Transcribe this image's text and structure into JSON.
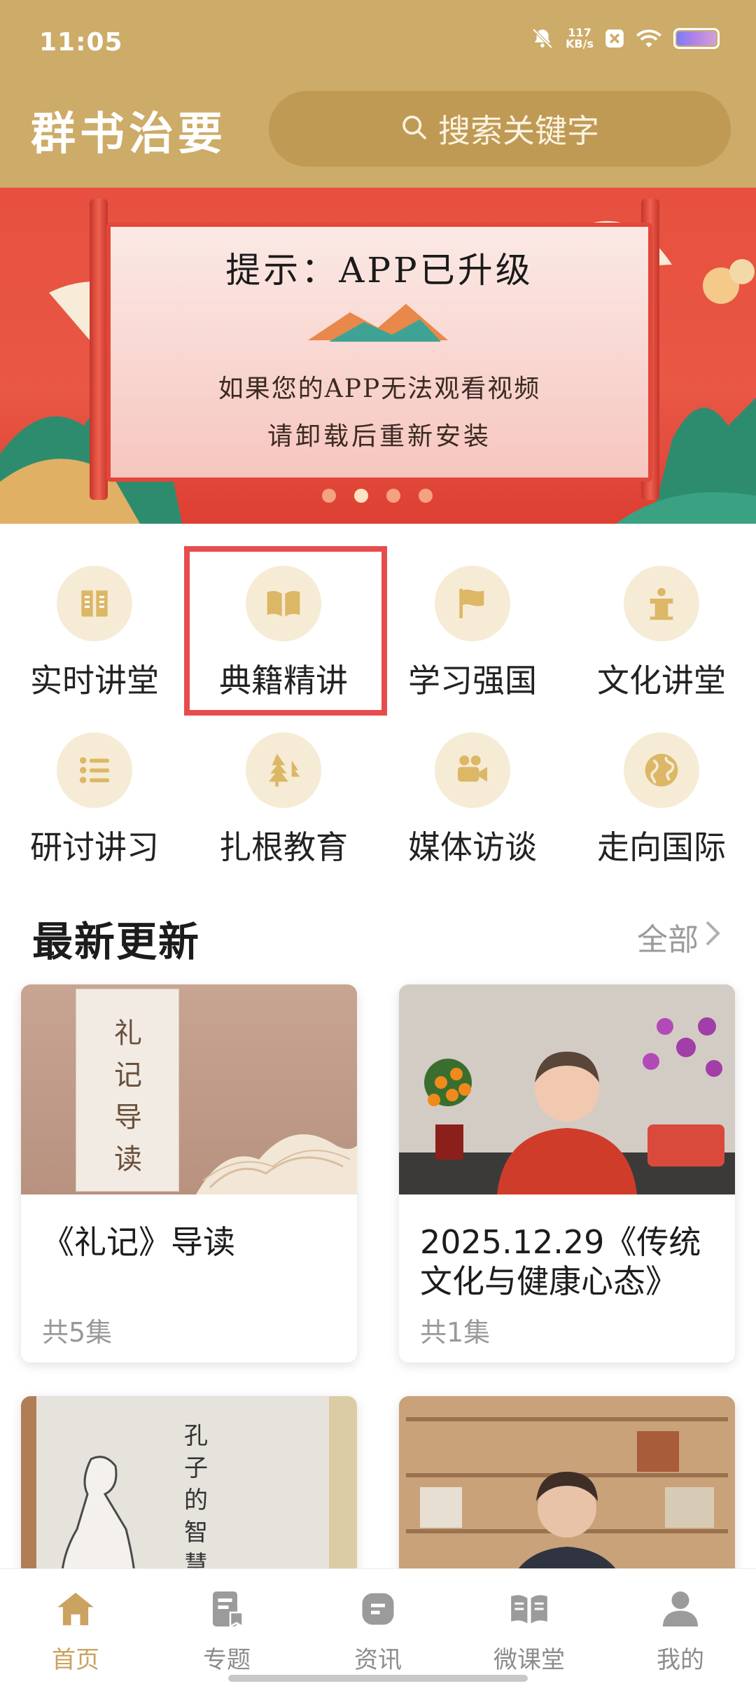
{
  "status": {
    "time": "11:05",
    "speed_value": "117",
    "speed_unit": "KB/s"
  },
  "header": {
    "brand": "群书治要",
    "search_placeholder": "搜索关键字"
  },
  "banner": {
    "title": "提示：APP已升级",
    "line1": "如果您的APP无法观看视频",
    "line2": "请卸载后重新安装",
    "dots": 4,
    "active_dot": 2
  },
  "categories": [
    {
      "label": "实时讲堂",
      "icon": "lecture-book-icon"
    },
    {
      "label": "典籍精讲",
      "icon": "open-book-icon"
    },
    {
      "label": "学习强国",
      "icon": "flag-icon"
    },
    {
      "label": "文化讲堂",
      "icon": "podium-icon"
    },
    {
      "label": "研讨讲习",
      "icon": "list-icon"
    },
    {
      "label": "扎根教育",
      "icon": "tree-icon"
    },
    {
      "label": "媒体访谈",
      "icon": "video-camera-icon"
    },
    {
      "label": "走向国际",
      "icon": "globe-icon"
    }
  ],
  "section": {
    "title": "最新更新",
    "more": "全部"
  },
  "cards": [
    {
      "title": "《礼记》导读",
      "count": "共5集",
      "cover_text": "礼记导读"
    },
    {
      "title": "2025.12.29《传统文化与健康心态》",
      "count": "共1集"
    },
    {
      "title": "",
      "count": "",
      "cover_text": "孔子的智慧"
    },
    {
      "title": "",
      "count": ""
    }
  ],
  "tabs": [
    {
      "label": "首页",
      "icon": "home-icon",
      "active": true
    },
    {
      "label": "专题",
      "icon": "topic-icon",
      "active": false
    },
    {
      "label": "资讯",
      "icon": "news-icon",
      "active": false
    },
    {
      "label": "微课堂",
      "icon": "micro-class-icon",
      "active": false
    },
    {
      "label": "我的",
      "icon": "user-icon",
      "active": false
    }
  ],
  "colors": {
    "brand_gold": "#cdab68",
    "active_tab": "#c9a35f",
    "highlight": "#e74c4c"
  }
}
